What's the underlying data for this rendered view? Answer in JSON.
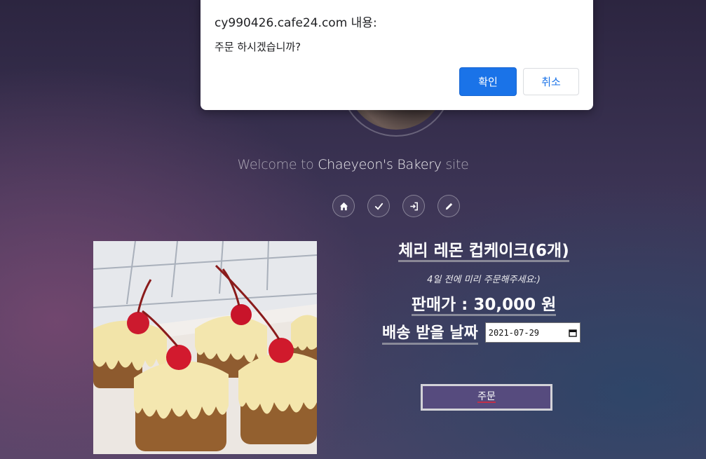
{
  "dialog": {
    "title": "cy990426.cafe24.com 내용:",
    "message": "주문 하시겠습니까?",
    "ok_label": "확인",
    "cancel_label": "취소"
  },
  "header": {
    "welcome_prefix": "Welcome to ",
    "welcome_brand": "Chaeyeon's Bakery",
    "welcome_suffix": " site",
    "nav_icons": [
      "home-icon",
      "check-icon",
      "login-icon",
      "pencil-icon"
    ]
  },
  "product": {
    "name": "체리 레몬 컵케이크(6개)",
    "note": "4일 전에 미리 주문해주세요:)",
    "price": "판매가 : 30,000 원",
    "date_label": "배송 받을 날짜",
    "date_value": "2021-07-29",
    "order_label": "주문"
  },
  "colors": {
    "order_button_bg": "#564b7e",
    "dialog_ok_bg": "#1a73e8"
  }
}
